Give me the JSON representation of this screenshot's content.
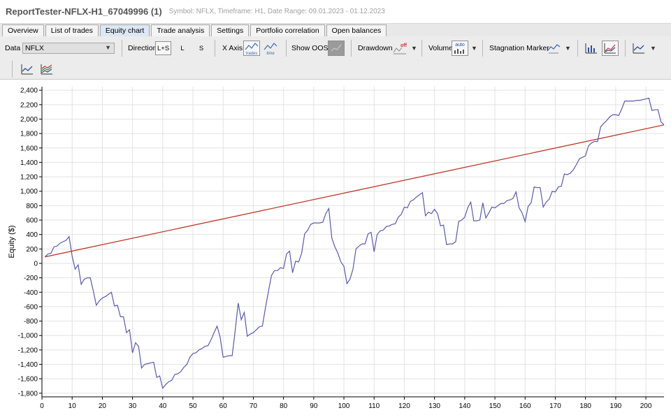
{
  "window": {
    "title": "ReportTester-NFLX-H1_67049996 (1)",
    "subtitle": "Symbol: NFLX, Timeframe: H1, Date Range: 09.01.2023 - 01.12.2023"
  },
  "tabs": [
    {
      "label": "Overview"
    },
    {
      "label": "List of trades"
    },
    {
      "label": "Equity chart"
    },
    {
      "label": "Trade analysis"
    },
    {
      "label": "Settings"
    },
    {
      "label": "Portfolio correlation"
    },
    {
      "label": "Open balances"
    }
  ],
  "active_tab": "Equity chart",
  "toolbar": {
    "data_label": "Data",
    "data_value": "NFLX",
    "direction_label": "Direction",
    "direction_options": [
      "L+S",
      "L",
      "S"
    ],
    "direction_selected": "L+S",
    "xaxis_label": "X Axis",
    "xaxis_trades": "trades",
    "xaxis_time": "time",
    "show_oos_label": "Show OOS",
    "drawdown_label": "Drawdown",
    "drawdown_icon_text": "off",
    "volume_label": "Volume",
    "volume_icon_text": "auto",
    "stagnation_label": "Stagnation Marker"
  },
  "colors": {
    "equity_line": "#5a5aa8",
    "trend_line": "#c0392b",
    "grid": "#e2e2e2",
    "active_tab": "#dbe8f5"
  },
  "chart_data": {
    "type": "line",
    "xlabel": "",
    "ylabel": "Equity ($)",
    "xlim": [
      0,
      206
    ],
    "ylim": [
      -1850,
      2450
    ],
    "xticks": [
      0,
      10,
      20,
      30,
      40,
      50,
      60,
      70,
      80,
      90,
      100,
      110,
      120,
      130,
      140,
      150,
      160,
      170,
      180,
      190,
      200
    ],
    "yticks": [
      -1800,
      -1600,
      -1400,
      -1200,
      -1000,
      -800,
      -600,
      -400,
      -200,
      0,
      200,
      400,
      600,
      800,
      1000,
      1200,
      1400,
      1600,
      1800,
      2000,
      2200,
      2400
    ],
    "grid": true,
    "series": [
      {
        "type": "line",
        "points": [
          [
            1,
            90
          ],
          [
            2,
            130
          ],
          [
            3,
            140
          ],
          [
            4,
            230
          ],
          [
            5,
            240
          ],
          [
            6,
            280
          ],
          [
            7,
            300
          ],
          [
            8,
            320
          ],
          [
            9,
            370
          ],
          [
            10,
            100
          ],
          [
            11,
            -80
          ],
          [
            12,
            -20
          ],
          [
            13,
            -290
          ],
          [
            14,
            -220
          ],
          [
            15,
            -200
          ],
          [
            16,
            -200
          ],
          [
            17,
            -380
          ],
          [
            18,
            -580
          ],
          [
            19,
            -520
          ],
          [
            20,
            -480
          ],
          [
            21,
            -460
          ],
          [
            22,
            -430
          ],
          [
            23,
            -400
          ],
          [
            24,
            -590
          ],
          [
            25,
            -580
          ],
          [
            26,
            -740
          ],
          [
            27,
            -740
          ],
          [
            28,
            -960
          ],
          [
            29,
            -920
          ],
          [
            30,
            -1240
          ],
          [
            31,
            -1100
          ],
          [
            32,
            -1150
          ],
          [
            33,
            -1450
          ],
          [
            34,
            -1400
          ],
          [
            35,
            -1390
          ],
          [
            36,
            -1380
          ],
          [
            37,
            -1370
          ],
          [
            38,
            -1580
          ],
          [
            39,
            -1560
          ],
          [
            40,
            -1730
          ],
          [
            41,
            -1680
          ],
          [
            42,
            -1640
          ],
          [
            43,
            -1620
          ],
          [
            44,
            -1540
          ],
          [
            45,
            -1530
          ],
          [
            46,
            -1500
          ],
          [
            47,
            -1440
          ],
          [
            48,
            -1400
          ],
          [
            49,
            -1300
          ],
          [
            50,
            -1250
          ],
          [
            51,
            -1240
          ],
          [
            52,
            -1200
          ],
          [
            53,
            -1180
          ],
          [
            54,
            -1150
          ],
          [
            55,
            -1140
          ],
          [
            56,
            -1060
          ],
          [
            57,
            -960
          ],
          [
            58,
            -870
          ],
          [
            59,
            -1020
          ],
          [
            60,
            -1300
          ],
          [
            61,
            -1290
          ],
          [
            62,
            -1280
          ],
          [
            63,
            -1280
          ],
          [
            64,
            -930
          ],
          [
            65,
            -550
          ],
          [
            66,
            -780
          ],
          [
            67,
            -680
          ],
          [
            68,
            -1010
          ],
          [
            69,
            -980
          ],
          [
            70,
            -960
          ],
          [
            71,
            -920
          ],
          [
            72,
            -880
          ],
          [
            73,
            -870
          ],
          [
            74,
            -620
          ],
          [
            75,
            -390
          ],
          [
            76,
            -170
          ],
          [
            77,
            -100
          ],
          [
            78,
            -100
          ],
          [
            79,
            -60
          ],
          [
            80,
            -70
          ],
          [
            81,
            130
          ],
          [
            82,
            170
          ],
          [
            83,
            -130
          ],
          [
            84,
            30
          ],
          [
            85,
            20
          ],
          [
            86,
            140
          ],
          [
            87,
            410
          ],
          [
            88,
            460
          ],
          [
            89,
            540
          ],
          [
            90,
            560
          ],
          [
            91,
            560
          ],
          [
            92,
            560
          ],
          [
            93,
            570
          ],
          [
            94,
            690
          ],
          [
            95,
            760
          ],
          [
            96,
            350
          ],
          [
            97,
            230
          ],
          [
            98,
            140
          ],
          [
            99,
            20
          ],
          [
            100,
            -40
          ],
          [
            101,
            -280
          ],
          [
            102,
            -220
          ],
          [
            103,
            -80
          ],
          [
            104,
            200
          ],
          [
            105,
            240
          ],
          [
            106,
            270
          ],
          [
            107,
            270
          ],
          [
            108,
            410
          ],
          [
            109,
            430
          ],
          [
            110,
            160
          ],
          [
            111,
            400
          ],
          [
            112,
            450
          ],
          [
            113,
            460
          ],
          [
            114,
            510
          ],
          [
            115,
            520
          ],
          [
            116,
            540
          ],
          [
            117,
            550
          ],
          [
            118,
            640
          ],
          [
            119,
            680
          ],
          [
            120,
            780
          ],
          [
            121,
            770
          ],
          [
            122,
            860
          ],
          [
            123,
            880
          ],
          [
            124,
            920
          ],
          [
            125,
            950
          ],
          [
            126,
            980
          ],
          [
            127,
            660
          ],
          [
            128,
            710
          ],
          [
            129,
            690
          ],
          [
            130,
            750
          ],
          [
            131,
            690
          ],
          [
            132,
            520
          ],
          [
            133,
            530
          ],
          [
            134,
            260
          ],
          [
            135,
            270
          ],
          [
            136,
            270
          ],
          [
            137,
            300
          ],
          [
            138,
            580
          ],
          [
            139,
            600
          ],
          [
            140,
            640
          ],
          [
            141,
            770
          ],
          [
            142,
            850
          ],
          [
            143,
            590
          ],
          [
            144,
            590
          ],
          [
            145,
            600
          ],
          [
            146,
            840
          ],
          [
            147,
            630
          ],
          [
            148,
            700
          ],
          [
            149,
            780
          ],
          [
            150,
            770
          ],
          [
            151,
            800
          ],
          [
            152,
            830
          ],
          [
            153,
            830
          ],
          [
            154,
            870
          ],
          [
            155,
            880
          ],
          [
            156,
            900
          ],
          [
            157,
            990
          ],
          [
            158,
            770
          ],
          [
            159,
            700
          ],
          [
            160,
            580
          ],
          [
            161,
            790
          ],
          [
            162,
            840
          ],
          [
            163,
            1060
          ],
          [
            164,
            1050
          ],
          [
            165,
            1050
          ],
          [
            166,
            780
          ],
          [
            167,
            850
          ],
          [
            168,
            890
          ],
          [
            169,
            1000
          ],
          [
            170,
            990
          ],
          [
            171,
            1060
          ],
          [
            172,
            1070
          ],
          [
            173,
            1240
          ],
          [
            174,
            1230
          ],
          [
            175,
            1250
          ],
          [
            176,
            1300
          ],
          [
            177,
            1370
          ],
          [
            178,
            1450
          ],
          [
            179,
            1470
          ],
          [
            180,
            1490
          ],
          [
            181,
            1630
          ],
          [
            182,
            1670
          ],
          [
            183,
            1690
          ],
          [
            184,
            1690
          ],
          [
            185,
            1890
          ],
          [
            186,
            1940
          ],
          [
            187,
            1980
          ],
          [
            188,
            2030
          ],
          [
            189,
            2060
          ],
          [
            190,
            2060
          ],
          [
            191,
            2050
          ],
          [
            192,
            2140
          ],
          [
            193,
            2250
          ],
          [
            194,
            2250
          ],
          [
            195,
            2250
          ],
          [
            196,
            2250
          ],
          [
            197,
            2260
          ],
          [
            198,
            2260
          ],
          [
            199,
            2270
          ],
          [
            200,
            2280
          ],
          [
            201,
            2290
          ],
          [
            202,
            2120
          ],
          [
            203,
            2130
          ],
          [
            204,
            2130
          ],
          [
            205,
            1960
          ],
          [
            206,
            1920
          ]
        ]
      },
      {
        "type": "line",
        "points": [
          [
            1,
            90
          ],
          [
            206,
            1920
          ]
        ]
      }
    ]
  }
}
